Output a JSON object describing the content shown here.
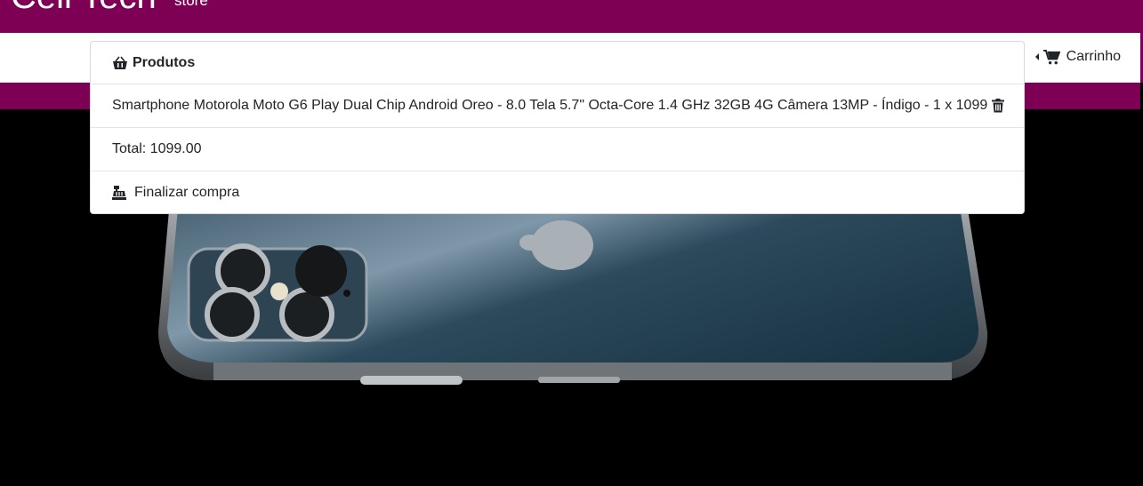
{
  "brand": {
    "name": "Cell Tech",
    "suffix": "store"
  },
  "navbar": {
    "cart_label": "Carrinho"
  },
  "cart_dropdown": {
    "header": "Produtos",
    "items": [
      {
        "text": "Smartphone Motorola Moto G6 Play Dual Chip Android Oreo - 8.0 Tela 5.7\" Octa-Core 1.4 GHz 32GB 4G Câmera 13MP - Índigo - 1 x 1099"
      }
    ],
    "total": "Total: 1099.00",
    "checkout_label": "Finalizar compra"
  },
  "colors": {
    "brand": "#7d0055",
    "hero_bg": "#000000"
  },
  "icons": [
    "shopping-basket-icon",
    "shopping-cart-icon",
    "trash-icon",
    "cash-register-icon"
  ]
}
